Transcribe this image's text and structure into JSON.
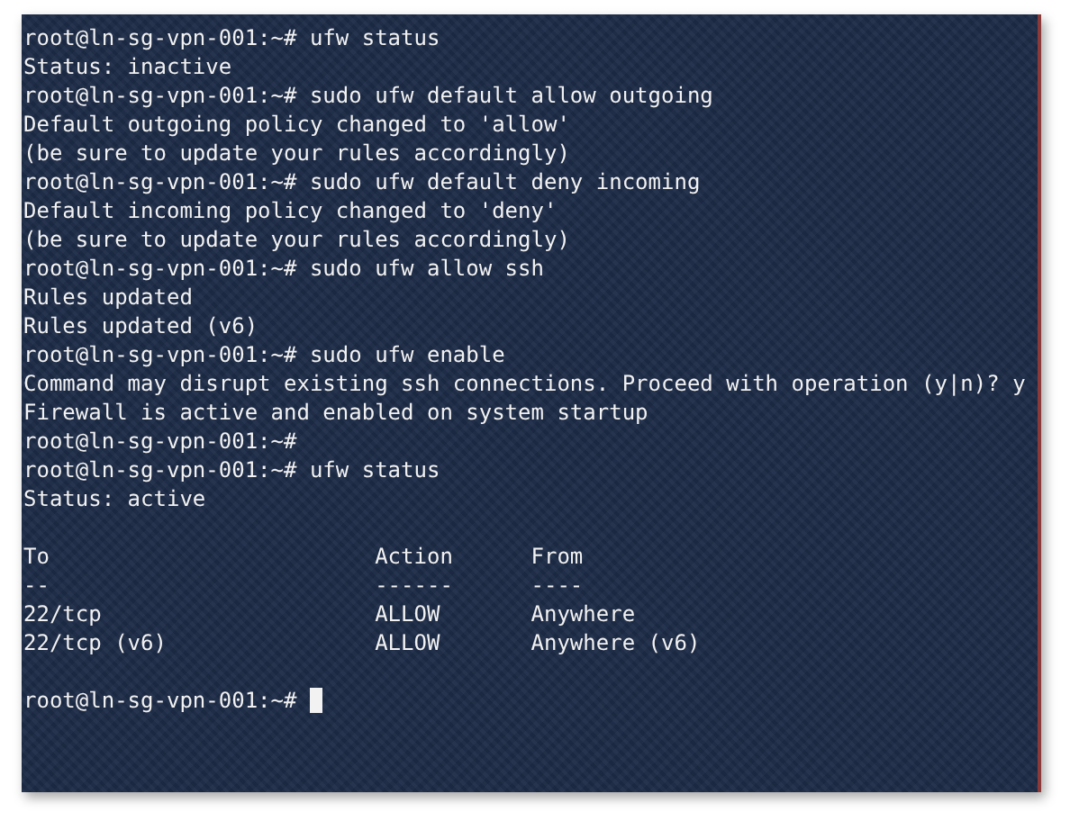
{
  "terminal": {
    "cursor": true,
    "lines": [
      {
        "kind": "text",
        "text": "root@ln-sg-vpn-001:~# ufw status"
      },
      {
        "kind": "text",
        "text": "Status: inactive"
      },
      {
        "kind": "text",
        "text": "root@ln-sg-vpn-001:~# sudo ufw default allow outgoing"
      },
      {
        "kind": "text",
        "text": "Default outgoing policy changed to 'allow'"
      },
      {
        "kind": "text",
        "text": "(be sure to update your rules accordingly)"
      },
      {
        "kind": "text",
        "text": "root@ln-sg-vpn-001:~# sudo ufw default deny incoming"
      },
      {
        "kind": "text",
        "text": "Default incoming policy changed to 'deny'"
      },
      {
        "kind": "text",
        "text": "(be sure to update your rules accordingly)"
      },
      {
        "kind": "text",
        "text": "root@ln-sg-vpn-001:~# sudo ufw allow ssh"
      },
      {
        "kind": "text",
        "text": "Rules updated"
      },
      {
        "kind": "text",
        "text": "Rules updated (v6)"
      },
      {
        "kind": "text",
        "text": "root@ln-sg-vpn-001:~# sudo ufw enable"
      },
      {
        "kind": "text",
        "text": "Command may disrupt existing ssh connections. Proceed with operation (y|n)? y"
      },
      {
        "kind": "text",
        "text": "Firewall is active and enabled on system startup"
      },
      {
        "kind": "text",
        "text": "root@ln-sg-vpn-001:~#"
      },
      {
        "kind": "text",
        "text": "root@ln-sg-vpn-001:~# ufw status"
      },
      {
        "kind": "text",
        "text": "Status: active"
      },
      {
        "kind": "blank"
      },
      {
        "kind": "text",
        "text": "To                         Action      From"
      },
      {
        "kind": "text",
        "text": "--                         ------      ----"
      },
      {
        "kind": "text",
        "text": "22/tcp                     ALLOW       Anywhere"
      },
      {
        "kind": "text",
        "text": "22/tcp (v6)                ALLOW       Anywhere (v6)"
      },
      {
        "kind": "blank"
      },
      {
        "kind": "prompt",
        "text": "root@ln-sg-vpn-001:~#"
      }
    ]
  }
}
